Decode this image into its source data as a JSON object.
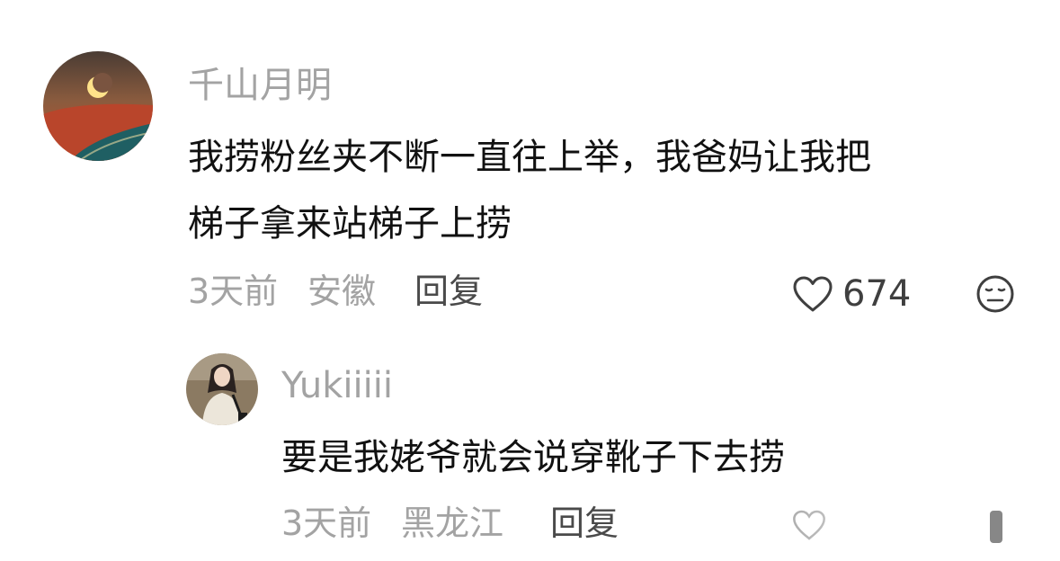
{
  "comments": [
    {
      "username": "千山月明",
      "text_line1": "我捞粉丝夹不断一直往上举，我爸妈让我把",
      "text_line2": "梯子拿来站梯子上捞",
      "time": "3天前",
      "location": "安徽",
      "reply_label": "回复",
      "like_count": "674",
      "avatar_icon": "crescent-moon-avatar-icon"
    }
  ],
  "replies": [
    {
      "username": "Yukiiiii",
      "text": "要是我姥爷就会说穿靴子下去捞",
      "time": "3天前",
      "location": "黑龙江",
      "reply_label": "回复",
      "avatar_icon": "girl-portrait-avatar-icon"
    }
  ],
  "icons": {
    "like": "heart-outline-icon",
    "dislike": "neutral-face-icon"
  },
  "colors": {
    "username": "#a3a3a3",
    "content": "#111111",
    "meta": "#a3a3a3",
    "reply": "#4a4a4a"
  }
}
